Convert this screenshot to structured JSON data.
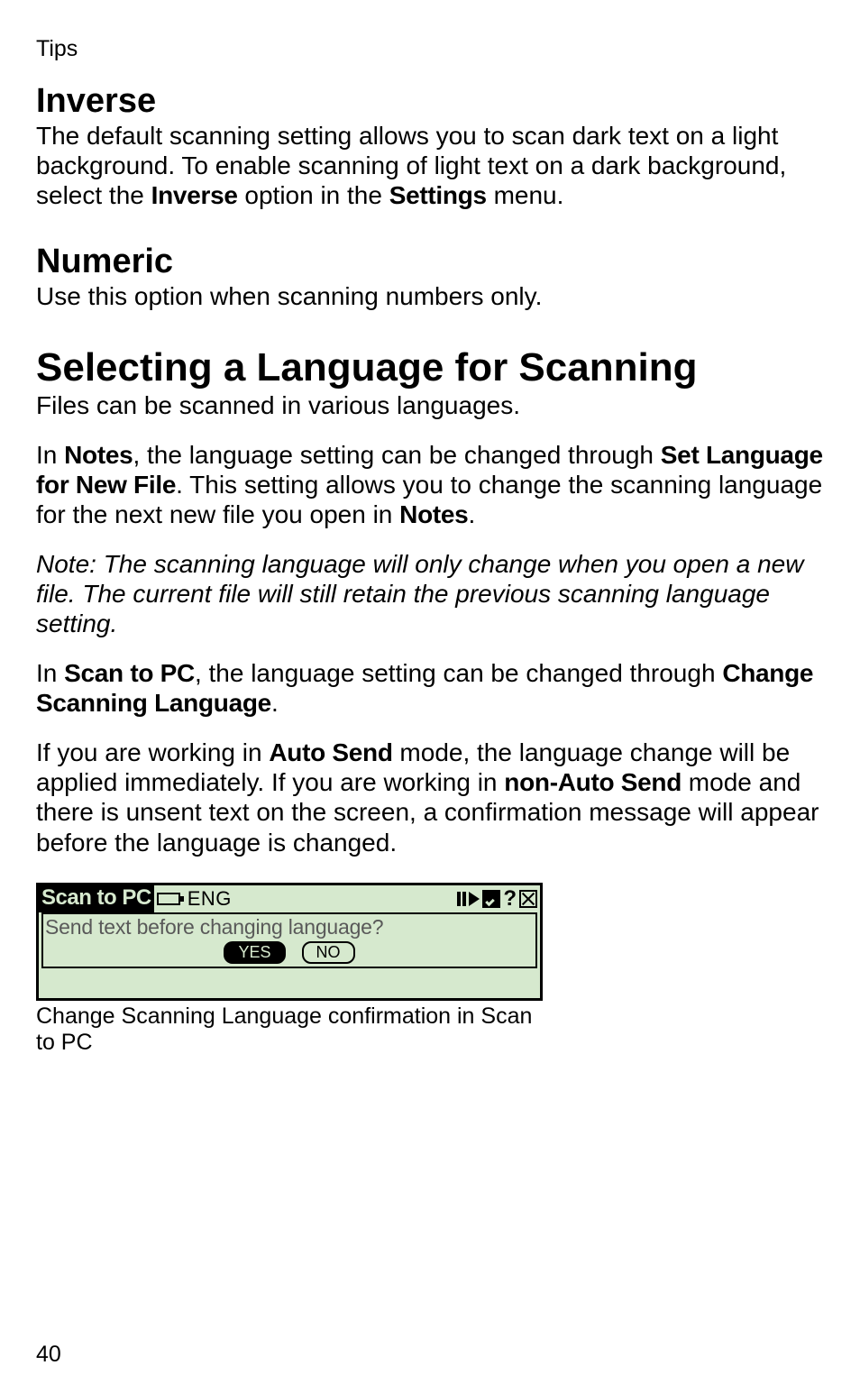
{
  "header": {
    "tips": "Tips"
  },
  "inverse": {
    "heading": "Inverse",
    "p1a": "The default scanning setting allows you to scan dark text on a light background. To enable scanning of light text on a dark background, select the ",
    "bold1": "Inverse",
    "p1b": " option in the ",
    "bold2": "Settings",
    "p1c": " menu."
  },
  "numeric": {
    "heading": "Numeric",
    "p1": "Use this option when scanning numbers only."
  },
  "selectlang": {
    "heading": "Selecting a Language for Scanning",
    "p1": "Files can be scanned in various languages.",
    "p2a": "In ",
    "p2b1": "Notes",
    "p2c": ", the language setting can be changed through ",
    "p2b2": "Set Language for New File",
    "p2d": ". This setting allows you to change the scanning language for the next new file you open in ",
    "p2b3": "Notes",
    "p2e": ".",
    "note": "Note: The scanning language will only change when you open a new file. The current file will still retain the previous scanning language setting.",
    "p3a": "In ",
    "p3b1": "Scan to PC",
    "p3c": ", the language setting can be changed through ",
    "p3b2": "Change Scanning Language",
    "p3d": ".",
    "p4a": "If you are working in ",
    "p4b1": "Auto Send",
    "p4b": " mode, the language change will be applied immediately. If you are working in ",
    "p4b2": "non-Auto Send",
    "p4c": " mode and there is unsent text on the screen, a confirmation message will appear before the language is changed."
  },
  "lcd": {
    "title": "Scan to PC",
    "eng": "ENG",
    "dialog_msg": "Send text before changing language?",
    "yes": "YES",
    "no": "NO",
    "question": "?"
  },
  "caption": "Change Scanning Language confirmation in Scan to PC",
  "page": "40"
}
